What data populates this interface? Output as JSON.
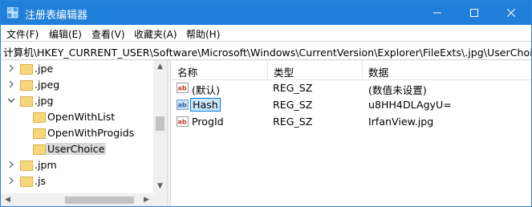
{
  "window": {
    "title": "注册表编辑器",
    "icon": "registry-editor-icon",
    "accent": "#1f7fd9"
  },
  "menu": {
    "items": [
      {
        "label": "文件(F)"
      },
      {
        "label": "编辑(E)"
      },
      {
        "label": "查看(V)"
      },
      {
        "label": "收藏夹(A)"
      },
      {
        "label": "帮助(H)"
      }
    ]
  },
  "address": {
    "path": "计算机\\HKEY_CURRENT_USER\\Software\\Microsoft\\Windows\\CurrentVersion\\Explorer\\FileExts\\.jpg\\UserChoice"
  },
  "tree": {
    "items": [
      {
        "label": ".jpe",
        "expander": "collapsed"
      },
      {
        "label": ".jpeg",
        "expander": "collapsed"
      },
      {
        "label": ".jpg",
        "expander": "expanded"
      },
      {
        "label": "OpenWithList",
        "expander": "none"
      },
      {
        "label": "OpenWithProgids",
        "expander": "none"
      },
      {
        "label": "UserChoice",
        "expander": "none",
        "selected": true
      },
      {
        "label": ".jpm",
        "expander": "collapsed"
      },
      {
        "label": ".js",
        "expander": "collapsed"
      }
    ]
  },
  "list": {
    "columns": {
      "name": "名称",
      "type": "类型",
      "data": "数据"
    },
    "rows": [
      {
        "name": "(默认)",
        "type": "REG_SZ",
        "data": "(数值未设置)"
      },
      {
        "name": "Hash",
        "type": "REG_SZ",
        "data": "u8HH4DLAgyU=",
        "selected": true
      },
      {
        "name": "ProgId",
        "type": "REG_SZ",
        "data": "IrfanView.jpg"
      }
    ]
  }
}
